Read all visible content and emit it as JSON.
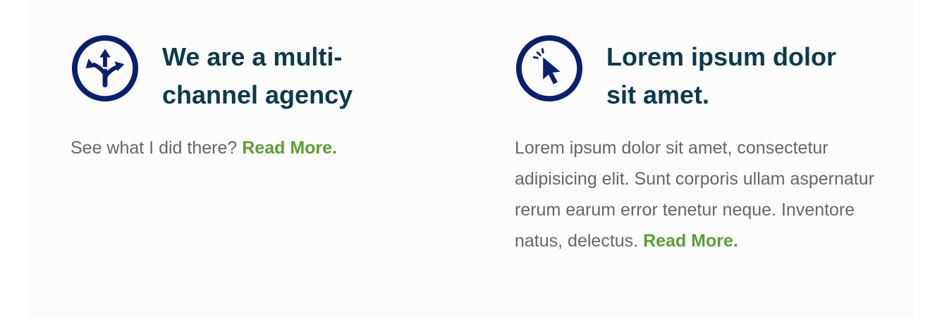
{
  "features": [
    {
      "icon": "split-arrows-icon",
      "title": "We are a multi-channel agency",
      "body": "See what I did there?",
      "link": "Read More."
    },
    {
      "icon": "cursor-click-icon",
      "title": "Lorem ipsum dolor sit amet.",
      "body": "Lorem ipsum dolor sit amet, consectetur adipisicing elit. Sunt corporis ullam aspernatur rerum earum error tenetur neque. Inventore natus, delectus.",
      "link": "Read More."
    }
  ],
  "colors": {
    "icon": "#0a1f6e",
    "title": "#0c3a4c",
    "body_text": "#666666",
    "link": "#5c9e32",
    "background": "#fcfcfc"
  }
}
